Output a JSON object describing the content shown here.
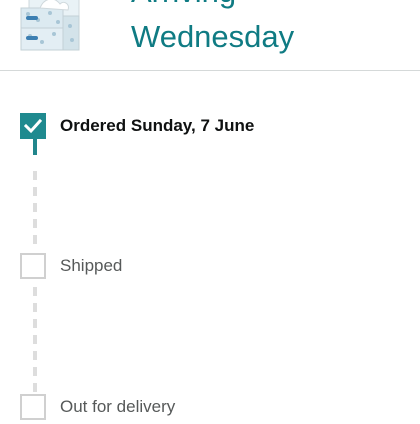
{
  "delivery": {
    "headline_line1": "Arriving",
    "headline_line2": "Wednesday",
    "product_image": "tissue-box-product-image"
  },
  "tracker": {
    "steps": [
      {
        "label": "Ordered Sunday, 7 June",
        "completed": true
      },
      {
        "label": "Shipped",
        "completed": false
      },
      {
        "label": "Out for delivery",
        "completed": false
      }
    ]
  },
  "colors": {
    "accent": "#0f7b83",
    "completed_box": "#1f8a8f",
    "pending_line": "#dddddd",
    "pending_box_border": "#d0d0d0"
  }
}
